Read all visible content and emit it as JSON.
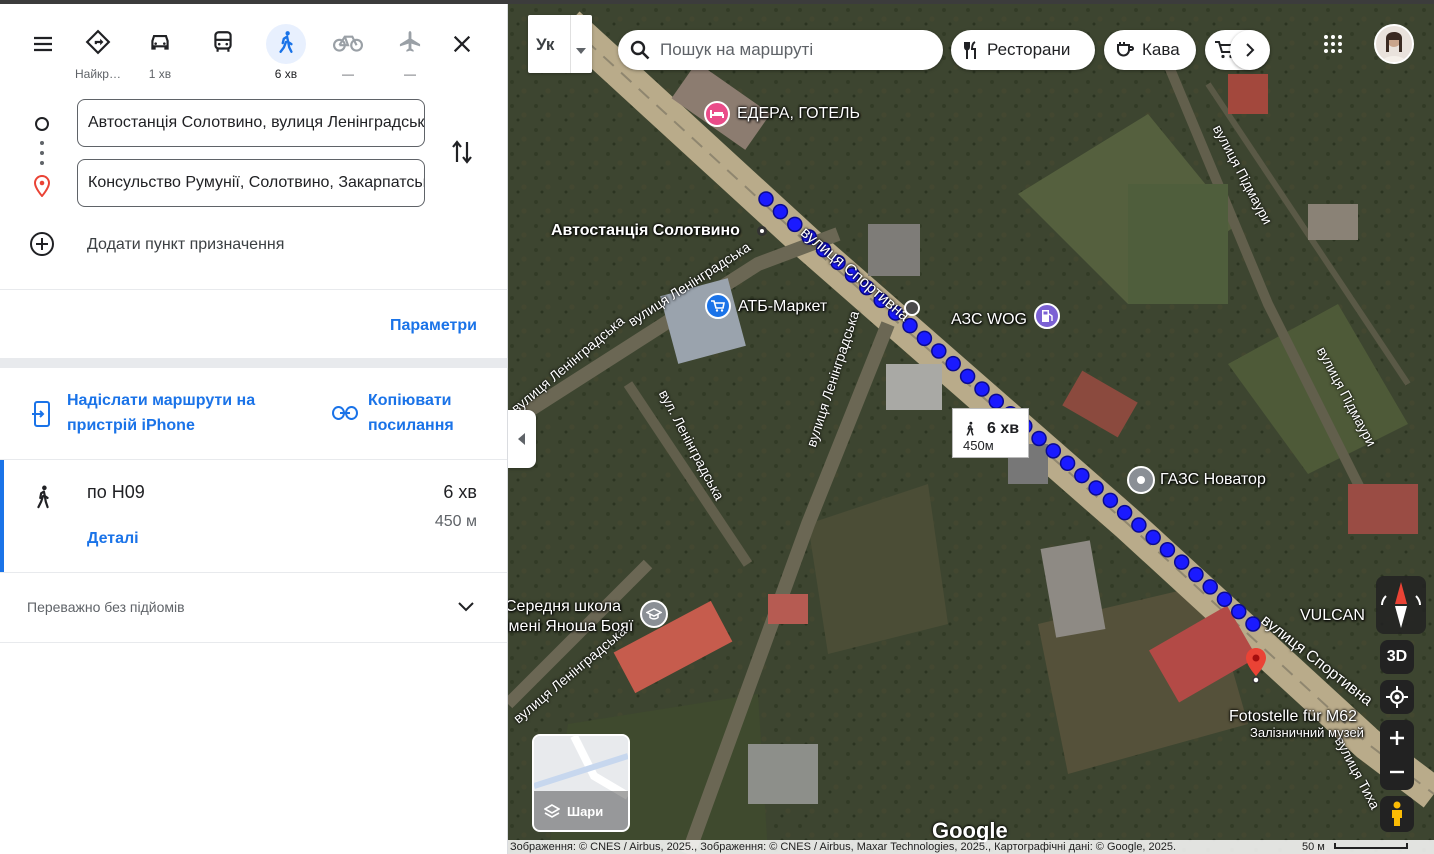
{
  "travel_modes": [
    {
      "id": "best",
      "label": "Найкр…",
      "icon": "directions-icon",
      "active": false
    },
    {
      "id": "car",
      "label": "1 хв",
      "icon": "car-icon",
      "active": false
    },
    {
      "id": "transit",
      "label": "",
      "icon": "bus-icon",
      "active": false
    },
    {
      "id": "walk",
      "label": "6 хв",
      "icon": "walk-icon",
      "active": true
    },
    {
      "id": "bike",
      "label": "—",
      "icon": "bike-icon",
      "active": false
    },
    {
      "id": "flight",
      "label": "—",
      "icon": "plane-icon",
      "active": false
    }
  ],
  "origin": "Автостанція Солотвино, вулиця Ленінградська",
  "destination": "Консульство Румунії, Солотвино, Закарпатська область",
  "add_destination": "Додати пункт призначення",
  "options_link": "Параметри",
  "share": {
    "send_line1": "Надіслати маршрути на",
    "send_line2": "пристрій iPhone",
    "copy_line1": "Копіювати",
    "copy_line2": "посилання"
  },
  "route": {
    "via": "по H09",
    "time": "6 хв",
    "distance": "450 м",
    "details": "Деталі"
  },
  "avoid_text": "Переважно без підйомів",
  "map": {
    "lang_button": "Ук",
    "search_placeholder": "Пошук на маршруті",
    "chips": [
      "Ресторани",
      "Кава"
    ],
    "travel_time": "6 хв",
    "travel_distance": "450м",
    "labels": {
      "hotel": "ЕДЕРА, ГОТЕЛЬ",
      "bus_station": "Автостанція Солотвино",
      "atb": "АТБ-Маркет",
      "wog": "АЗС WOG",
      "gas": "ГАЗС Новатор",
      "school1": "Середня школа",
      "school2": "імені Яноша Бояї",
      "vulcan": "VULCAN",
      "fotostelle": "Fotostelle für M62",
      "museum": "Залізничний музей"
    },
    "roads": {
      "sportyvna": "вулиця Спортивна",
      "sportyvna2": "вулиця Спортивна",
      "leningradska1": "вулиця Ленінградська",
      "leningradska2": "вулиця Ленінградська",
      "leningradska3": "вул. Ленінградська",
      "leningradska4": "вулиця Ленінградська",
      "leningradska5": "вулиця Ленінградська",
      "pidmaury1": "вулиця Підмаури",
      "pidmaury2": "вулиця Підмаури",
      "tycha": "вулиця Тиха"
    },
    "layers_label": "Шари",
    "btn_3d": "3D",
    "google": "Google",
    "attribution": "Зображення: © CNES / Airbus, 2025., Зображення: © CNES / Airbus, Maxar Technologies, 2025., Картографічні дані: © Google, 2025.",
    "scale": "50 м",
    "route_color": "#1a1aff",
    "destination_color": "#ea4335"
  }
}
